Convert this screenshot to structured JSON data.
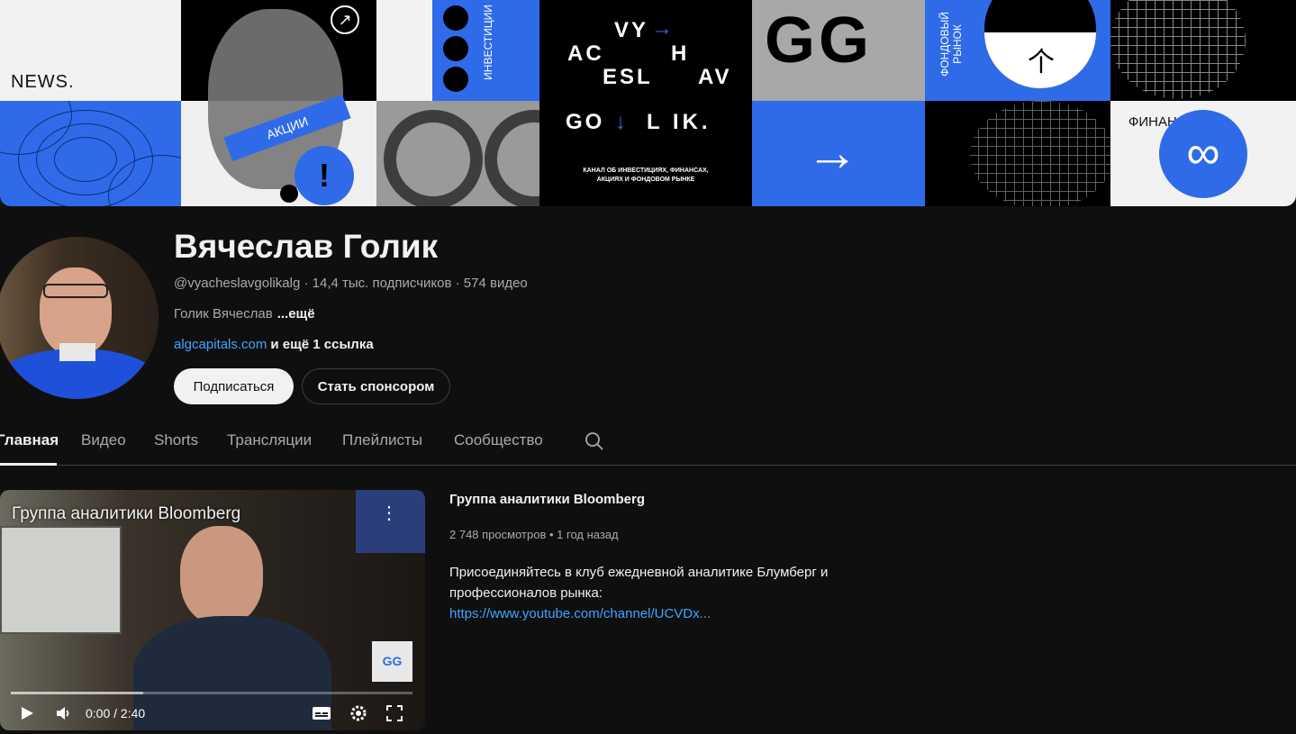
{
  "banner": {
    "news_label": "NEWS.",
    "stocks_label": "АКЦИИ",
    "investments_label": "ИНВЕСТИЦИИ",
    "logo_row1": "VY",
    "logo_row2a": "AC",
    "logo_row2b": "H",
    "logo_row3a": "ESL",
    "logo_row3b": "AV",
    "logo_row4": "GO",
    "logo_row4b": "L IK.",
    "tagline_line1": "КАНАЛ ОБ ИНВЕСТИЦИЯХ, ФИНАНСАХ,",
    "tagline_line2": "АКЦИЯХ И ФОНДОВОМ РЫНКЕ",
    "stock_market_line1": "ФОНДОВЫЙ",
    "stock_market_line2": "РЫНОК",
    "finance_label": "ФИНАНСЫ",
    "exclamation": "!",
    "big_letters": "GG",
    "accent_color": "#2f6be8"
  },
  "channel": {
    "name": "Вячеслав Голик",
    "handle": "@vyacheslavgolikalg",
    "subscribers": "14,4 тыс. подписчиков",
    "videos": "574 видео",
    "separator": " · ",
    "description": "Голик Вячеслав",
    "more": "...ещё",
    "link": "algcapitals.com",
    "more_links": "и ещё 1 ссылка",
    "subscribe_label": "Подписаться",
    "sponsor_label": "Стать спонсором"
  },
  "tabs": [
    {
      "label": "Главная"
    },
    {
      "label": "Видео"
    },
    {
      "label": "Shorts"
    },
    {
      "label": "Трансляции"
    },
    {
      "label": "Плейлисты"
    },
    {
      "label": "Сообщество"
    }
  ],
  "featured": {
    "player_title": "Группа аналитики Bloomberg",
    "time": "0:00 / 2:40",
    "progress": 0.33,
    "watermark": "GG",
    "title": "Группа аналитики Bloomberg",
    "views": "2 748 просмотров",
    "age": "1 год назад",
    "stats_sep": " • ",
    "desc_line1": "Присоединяйтесь в клуб ежедневной аналитике Блумберг и профессионалов рынка:",
    "desc_link": "https://www.youtube.com/channel/UCVDx..."
  },
  "colors": {
    "background": "#0f0f0f",
    "link": "#3ea6ff",
    "muted": "#aaaaaa"
  }
}
